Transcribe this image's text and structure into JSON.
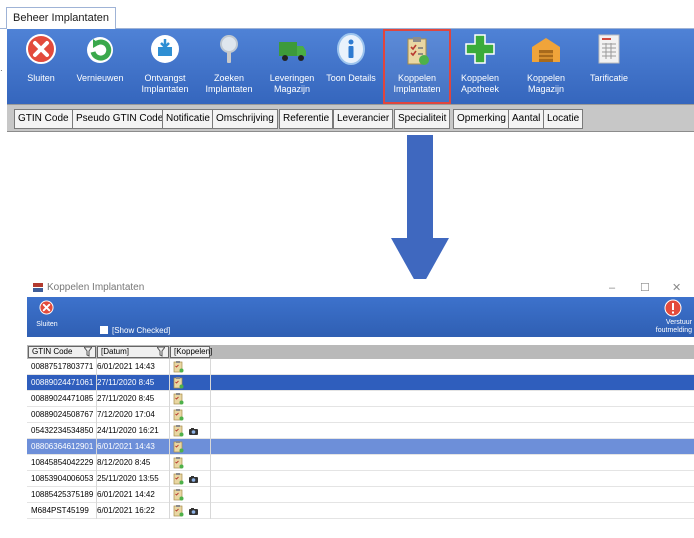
{
  "top_window": {
    "tab_label": "Beheer Implantaten",
    "ribbon_buttons": [
      {
        "label": "Sluiten",
        "icon": "close-icon",
        "highlighted": false
      },
      {
        "label": "Vernieuwen",
        "icon": "refresh-icon",
        "highlighted": false
      },
      {
        "label": "Ontvangst\nImplantaten",
        "icon": "receive-box-icon",
        "highlighted": false
      },
      {
        "label": "Zoeken\nImplantaten",
        "icon": "magnifier-icon",
        "highlighted": false
      },
      {
        "label": "Leveringen\nMagazijn",
        "icon": "truck-icon",
        "highlighted": false
      },
      {
        "label": "Toon Details",
        "icon": "info-icon",
        "highlighted": false
      },
      {
        "label": "Koppelen\nImplantaten",
        "icon": "clipboard-link-icon",
        "highlighted": true
      },
      {
        "label": "Koppelen\nApotheek",
        "icon": "pharmacy-cross-icon",
        "highlighted": false
      },
      {
        "label": "Koppelen\nMagazijn",
        "icon": "warehouse-icon",
        "highlighted": false
      },
      {
        "label": "Tarificatie",
        "icon": "price-list-icon",
        "highlighted": false
      }
    ],
    "column_headers": [
      "GTIN Code",
      "Pseudo GTIN Code",
      "Notificatie",
      "Omschrijving",
      "Referentie",
      "Leverancier",
      "Specialiteit",
      "Opmerking",
      "Aantal",
      "Locatie"
    ]
  },
  "dialog": {
    "title": "Koppelen Implantaten",
    "window_controls": {
      "minimize": "–",
      "maximize": "☐",
      "close": "✕"
    },
    "close_button_label": "Sluiten",
    "show_checked_label": "[Show Checked]",
    "verstuur_label": "Verstuur\nfoutmelding",
    "grid_headers": [
      "GTIN Code",
      "[Datum]",
      "[Koppelen]"
    ],
    "rows": [
      {
        "gtin": "00887517803771",
        "datum": "6/01/2021 14:43",
        "extra_icon": false,
        "selected": ""
      },
      {
        "gtin": "00889024471061",
        "datum": "27/11/2020 8:45",
        "extra_icon": false,
        "selected": "dark"
      },
      {
        "gtin": "00889024471085",
        "datum": "27/11/2020 8:45",
        "extra_icon": false,
        "selected": ""
      },
      {
        "gtin": "00889024508767",
        "datum": "7/12/2020 17:04",
        "extra_icon": false,
        "selected": ""
      },
      {
        "gtin": "05432234534850",
        "datum": "24/11/2020 16:21",
        "extra_icon": true,
        "selected": ""
      },
      {
        "gtin": "08806364612901",
        "datum": "6/01/2021 14:43",
        "extra_icon": false,
        "selected": "light"
      },
      {
        "gtin": "10845854042229",
        "datum": "8/12/2020 8:45",
        "extra_icon": false,
        "selected": ""
      },
      {
        "gtin": "10853904006053",
        "datum": "25/11/2020 13:55",
        "extra_icon": true,
        "selected": ""
      },
      {
        "gtin": "10885425375189",
        "datum": "6/01/2021 14:42",
        "extra_icon": false,
        "selected": ""
      },
      {
        "gtin": "M684PST45199",
        "datum": "6/01/2021 16:22",
        "extra_icon": true,
        "selected": ""
      }
    ]
  },
  "colors": {
    "ribbon_blue": "#3f72cc",
    "highlight_red": "#e0453d",
    "arrow_blue": "#3f68bf",
    "row_selected_dark": "#2f5ebd",
    "row_selected_light": "#6d8fd9"
  }
}
